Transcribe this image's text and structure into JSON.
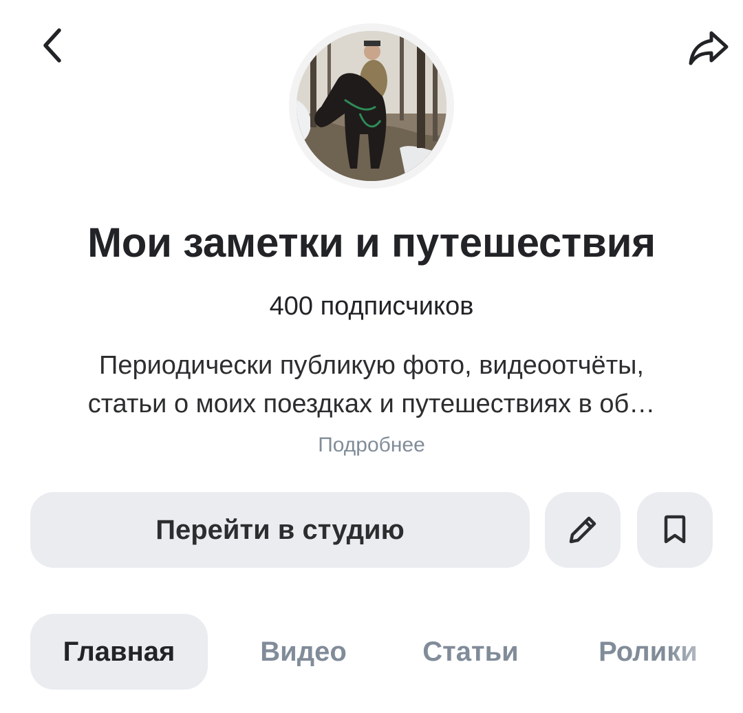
{
  "header": {
    "back_icon": "chevron-left-icon",
    "share_icon": "share-arrow-icon"
  },
  "channel": {
    "title": "Мои заметки и путешествия",
    "subscribers_count": "400",
    "subscribers_label": "подписчиков",
    "description_line1": "Периодически публикую фото, видеоотчёты,",
    "description_line2": "статьи о моих поездках и путешествиях в об…",
    "more_label": "Подробнее"
  },
  "actions": {
    "studio_label": "Перейти в студию",
    "edit_icon": "pencil-icon",
    "bookmark_icon": "bookmark-icon"
  },
  "tabs": [
    {
      "label": "Главная",
      "active": true
    },
    {
      "label": "Видео",
      "active": false
    },
    {
      "label": "Статьи",
      "active": false
    },
    {
      "label": "Ролики",
      "active": false
    }
  ],
  "colors": {
    "text": "#222326",
    "secondary": "#818c99",
    "button_bg": "#ebecf0"
  }
}
